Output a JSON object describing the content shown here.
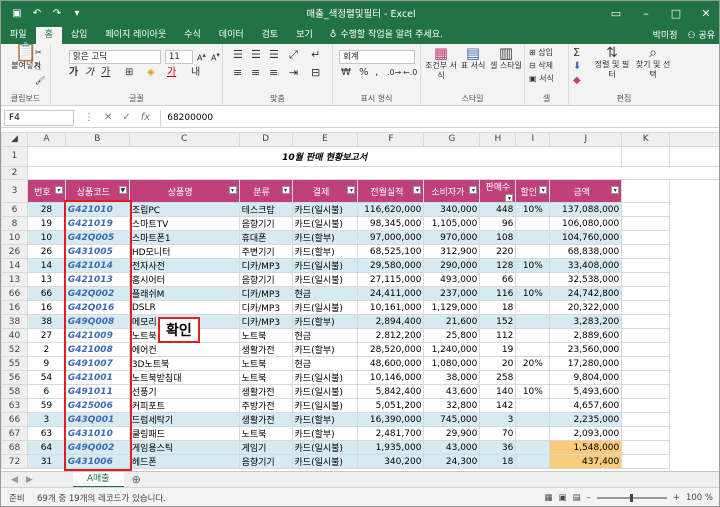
{
  "window": {
    "title": "매출_색정렬및필터 - Excel",
    "user": "박미정",
    "share": "공유"
  },
  "tabs": [
    "파일",
    "홈",
    "삽입",
    "페이지 레이아웃",
    "수식",
    "데이터",
    "검토",
    "보기"
  ],
  "tell_me": "수행할 작업을 알려 주세요.",
  "ribbon": {
    "paste": "붙여넣기",
    "clipboard": "클립보드",
    "font_name": "맑은 고딕",
    "font_size": "11",
    "font_group": "글꼴",
    "align_group": "맞춤",
    "number_format": "회계",
    "number_group": "표시 형식",
    "cond_format": "조건부 서식",
    "table_format": "표 서식",
    "cell_style": "셀 스타일",
    "style_group": "스타일",
    "insert": "삽입",
    "delete": "삭제",
    "format": "서식",
    "cell_group": "셀",
    "sort_filter": "정렬 및 필터",
    "find_select": "찾기 및 선택",
    "edit_group": "편집"
  },
  "formula_bar": {
    "name_box": "F4",
    "value": "68200000"
  },
  "columns": [
    "A",
    "B",
    "C",
    "D",
    "E",
    "F",
    "G",
    "H",
    "I",
    "J",
    "K"
  ],
  "sheet_title": "10월 판매 현황보고서",
  "headers": [
    "번호",
    "상품코드",
    "상품명",
    "분류",
    "결제",
    "전월실적",
    "소비자가",
    "판매수",
    "할인",
    "금액"
  ],
  "rows": [
    {
      "r": "6",
      "cells": [
        "28",
        "G421010",
        "조립PC",
        "테스크탑",
        "카드(일시불)",
        "116,620,000",
        "340,000",
        "448",
        "10%",
        "137,088,000"
      ],
      "band": "blue"
    },
    {
      "r": "8",
      "cells": [
        "19",
        "G421019",
        "스마트TV",
        "음향기기",
        "카드(일시불)",
        "98,345,000",
        "1,105,000",
        "96",
        "",
        "106,080,000"
      ],
      "band": "white"
    },
    {
      "r": "10",
      "cells": [
        "10",
        "G42Q005",
        "스마트폰1",
        "휴대폰",
        "카드(할부)",
        "97,000,000",
        "970,000",
        "108",
        "",
        "104,760,000"
      ],
      "band": "blue"
    },
    {
      "r": "26",
      "cells": [
        "26",
        "G431005",
        "HD모니터",
        "주변기기",
        "카드(할부)",
        "68,525,100",
        "312,900",
        "220",
        "",
        "68,838,000"
      ],
      "band": "white"
    },
    {
      "r": "14",
      "cells": [
        "14",
        "G421014",
        "전자사전",
        "디카/MP3",
        "카드(일시불)",
        "29,580,000",
        "290,000",
        "128",
        "10%",
        "33,408,000"
      ],
      "band": "blue"
    },
    {
      "r": "13",
      "cells": [
        "13",
        "G421013",
        "홈시어터",
        "음향기기",
        "카드(일시불)",
        "27,115,000",
        "493,000",
        "66",
        "",
        "32,538,000"
      ],
      "band": "white"
    },
    {
      "r": "66",
      "cells": [
        "66",
        "G42Q002",
        "플래쉬M",
        "디카/MP3",
        "현금",
        "24,411,000",
        "237,000",
        "116",
        "10%",
        "24,742,800"
      ],
      "band": "blue"
    },
    {
      "r": "16",
      "cells": [
        "16",
        "G42Q016",
        "DSLR",
        "디카/MP3",
        "카드(일시불)",
        "10,161,000",
        "1,129,000",
        "18",
        "",
        "20,322,000"
      ],
      "band": "white"
    },
    {
      "r": "38",
      "cells": [
        "38",
        "G49Q008",
        "메모리",
        "디카/MP3",
        "카드(할부)",
        "2,894,400",
        "21,600",
        "152",
        "",
        "3,283,200"
      ],
      "band": "blue"
    },
    {
      "r": "40",
      "cells": [
        "27",
        "G421009",
        "노트북",
        "노트북",
        "현금",
        "2,812,200",
        "25,800",
        "112",
        "",
        "2,889,600"
      ],
      "band": "white"
    },
    {
      "r": "52",
      "cells": [
        "2",
        "G421008",
        "에어컨",
        "생활가전",
        "카드(할부)",
        "28,520,000",
        "1,240,000",
        "19",
        "",
        "23,560,000"
      ],
      "band": "white"
    },
    {
      "r": "55",
      "cells": [
        "9",
        "G491007",
        "3D노트북",
        "노트북",
        "현금",
        "48,600,000",
        "1,080,000",
        "20",
        "20%",
        "17,280,000"
      ],
      "band": "white"
    },
    {
      "r": "56",
      "cells": [
        "54",
        "G421001",
        "노트북받침대",
        "노트북",
        "카드(일시불)",
        "10,146,000",
        "38,000",
        "258",
        "",
        "9,804,000"
      ],
      "band": "white"
    },
    {
      "r": "58",
      "cells": [
        "6",
        "G491011",
        "선풍기",
        "생활가전",
        "카드(일시불)",
        "5,842,400",
        "43,600",
        "140",
        "10%",
        "5,493,600"
      ],
      "band": "white"
    },
    {
      "r": "63",
      "cells": [
        "59",
        "G425006",
        "커피포트",
        "주방가전",
        "카드(일시불)",
        "5,051,200",
        "32,800",
        "142",
        "",
        "4,657,600"
      ],
      "band": "white"
    },
    {
      "r": "66",
      "cells": [
        "3",
        "G43Q001",
        "드럼세탁기",
        "생활가전",
        "카드(할부)",
        "16,390,000",
        "745,000",
        "3",
        "",
        "2,235,000"
      ],
      "band": "blue"
    },
    {
      "r": "67",
      "cells": [
        "63",
        "G431010",
        "쿨링패드",
        "노트북",
        "카드(할부)",
        "2,481,700",
        "29,900",
        "70",
        "",
        "2,093,000"
      ],
      "band": "white"
    },
    {
      "r": "68",
      "cells": [
        "64",
        "G49Q002",
        "게임용스틱",
        "게임기",
        "카드(일시불)",
        "1,935,000",
        "43,000",
        "36",
        "",
        "1,548,000"
      ],
      "band": "blue",
      "hl": true
    },
    {
      "r": "72",
      "cells": [
        "31",
        "G431006",
        "헤드폰",
        "음향기기",
        "카드(일시불)",
        "340,200",
        "24,300",
        "18",
        "",
        "437,400"
      ],
      "band": "blue",
      "hl": true
    }
  ],
  "annotation": {
    "label": "확인"
  },
  "sheet_tab": "A매출",
  "status": {
    "ready": "준비",
    "message": "69개 중 19개의 레코드가 있습니다.",
    "zoom": "100 %"
  },
  "colors": {
    "excel_green": "#217346",
    "header_pink": "#c0407a",
    "band_blue": "#d6eaf4",
    "highlight": "#f9cb7a",
    "code_blue": "#3d6cb4"
  }
}
